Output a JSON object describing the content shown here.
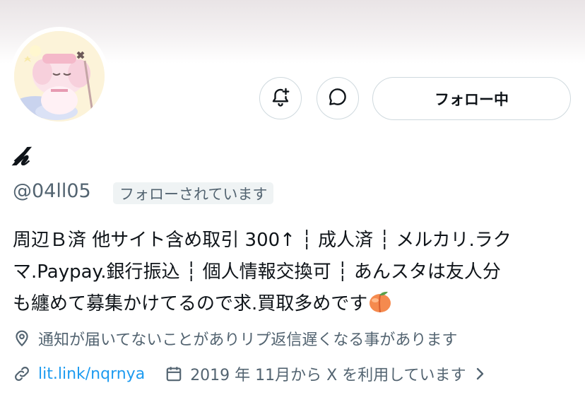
{
  "profile": {
    "display_name": "𝓱",
    "handle": "@04ll05",
    "follows_you_badge": "フォローされています"
  },
  "actions": {
    "follow_label": "フォロー中"
  },
  "bio": {
    "lines": [
      "周辺Ｂ済 他サイト含め取引 300↑ ┆ 成人済 ┆ メルカリ.ラク",
      "マ.Paypay.銀行振込 ┆ 個人情報交換可 ┆ あんスタは友人分",
      "も纏めて募集かけてるので求.買取多めです"
    ],
    "emoji": "peach"
  },
  "location": "通知が届いてないことがありリプ返信遅くなる事があります",
  "website": "lit.link/nqrnya",
  "joined": "2019 年 11月から X を利用しています",
  "icons": [
    "bell-plus-icon",
    "message-icon",
    "location-pin-icon",
    "link-icon",
    "calendar-icon",
    "chevron-right-icon"
  ],
  "colors": {
    "link": "#1d9bf0",
    "secondary_text": "#536471",
    "border": "#cfd9de"
  }
}
